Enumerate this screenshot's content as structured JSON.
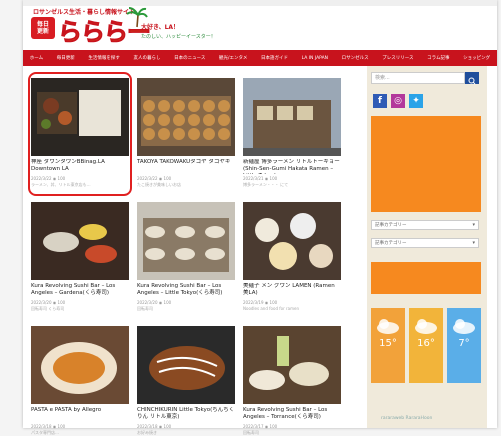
{
  "header": {
    "tagline": "ロサンゼルス生活・暮らし情報サイト",
    "logo_box": [
      "毎日",
      "更新"
    ],
    "logo_main": "らららー",
    "sub_line1": "大好き、LA！",
    "sub_line2": "たのしい、ハッピーイースター！"
  },
  "nav": {
    "items": [
      "ホーム",
      "毎日更新",
      "生活情報を探す",
      "友人の暮らし",
      "日本のニュース",
      "観光/エンタメ",
      "日本語ガイド",
      "LA IN JAPAN",
      "ロサンゼルス",
      "プレスリリース",
      "コラム記事",
      "ショッピング"
    ]
  },
  "posts": [
    {
      "title": "神座 ダウンタウンBBinag.LA Downtown LA",
      "meta": "2022/3/22  ◉ 100",
      "excerpt": "ラーメン、丼、リトル東京店も…",
      "img": "bento"
    },
    {
      "title": "TAKOYA TAKOWAKUタコヤ タコヤキ",
      "meta": "2022/3/22  ◉ 100",
      "excerpt": "たこ焼きが美味しいお店",
      "img": "takoyaki"
    },
    {
      "title": "新麺屋 博多ラーメン リトルトーキョー(Shin-Sen-Gumi Hakata Ramen – Little Tokyo)",
      "meta": "2022/3/21  ◉ 100",
      "excerpt": "博多ラーメン・・・ にて",
      "img": "building"
    },
    {
      "title": "Kura Revolving Sushi Bar – Los Angeles – Gardena(くら寿司)",
      "meta": "2022/3/20  ◉ 100",
      "excerpt": "回転寿司 くら寿司",
      "img": "table"
    },
    {
      "title": "Kura Revolving Sushi Bar – Los Angeles – Little Tokyo(くら寿司)",
      "meta": "2022/3/20  ◉ 100",
      "excerpt": "回転寿司",
      "img": "sushi"
    },
    {
      "title": "美麺子 メン グウン LAMEN (Ramen 美LA)",
      "meta": "2022/3/19  ◉ 100",
      "excerpt": "Noodles and food for ramen",
      "img": "dishes"
    },
    {
      "title": "PASTA e PASTA by Allegro",
      "meta": "2022/3/18  ◉ 100",
      "excerpt": "パスタ専門店…",
      "img": "pasta"
    },
    {
      "title": "CHINCHIKURIN Little Tokyo(ちんちくりん リトル東京)",
      "meta": "2022/3/18  ◉ 100",
      "excerpt": "お好み焼き",
      "img": "okonomi"
    },
    {
      "title": "Kura Revolving Sushi Bar – Los Angeles – Torrance(くら寿司)",
      "meta": "2022/3/17  ◉ 100",
      "excerpt": "回転寿司",
      "img": "drinks"
    }
  ],
  "sidebar": {
    "search_placeholder": "検索...",
    "select1": "記事カテゴリー",
    "select2": "記事カテゴリー",
    "weather": [
      {
        "temp": "15°",
        "color": "#f2a23a"
      },
      {
        "temp": "16°",
        "color": "#f2b43a"
      },
      {
        "temp": "7°",
        "color": "#5aaee8"
      }
    ],
    "footer_text": "rararaweb   RararaHoon"
  },
  "colors": {
    "brand_red": "#c8131d",
    "accent_orange": "#f6891f",
    "sidebar_bg": "#f0eadb",
    "search_btn": "#1f4e9c"
  }
}
